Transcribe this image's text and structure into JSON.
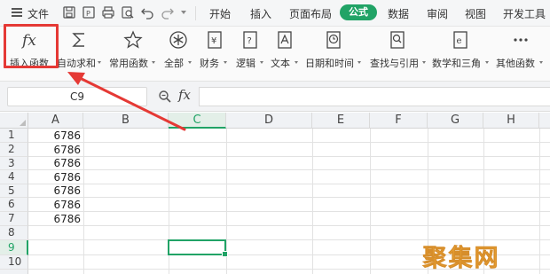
{
  "menubar": {
    "file_label": "文件",
    "tabs": [
      {
        "label": "开始",
        "active": false
      },
      {
        "label": "插入",
        "active": false
      },
      {
        "label": "页面布局",
        "active": false
      },
      {
        "label": "公式",
        "active": true
      },
      {
        "label": "数据",
        "active": false
      },
      {
        "label": "审阅",
        "active": false
      },
      {
        "label": "视图",
        "active": false
      },
      {
        "label": "开发工具",
        "active": false
      }
    ],
    "quick_access_icons": [
      "save-icon",
      "export-icon",
      "print-icon",
      "print-preview-icon",
      "undo-icon",
      "redo-icon"
    ]
  },
  "ribbon": {
    "items": [
      {
        "label": "插入函数",
        "icon": "fx-icon",
        "dropdown": false
      },
      {
        "label": "自动求和",
        "icon": "sigma-icon",
        "dropdown": true
      },
      {
        "label": "常用函数",
        "icon": "star-icon",
        "dropdown": true
      },
      {
        "label": "全部",
        "icon": "asterisk-icon",
        "dropdown": true
      },
      {
        "label": "财务",
        "icon": "yen-book-icon",
        "dropdown": true
      },
      {
        "label": "逻辑",
        "icon": "question-book-icon",
        "dropdown": true
      },
      {
        "label": "文本",
        "icon": "text-a-book-icon",
        "dropdown": true
      },
      {
        "label": "日期和时间",
        "icon": "clock-book-icon",
        "dropdown": true
      },
      {
        "label": "查找与引用",
        "icon": "search-book-icon",
        "dropdown": true
      },
      {
        "label": "数学和三角",
        "icon": "theta-book-icon",
        "dropdown": true
      },
      {
        "label": "其他函数",
        "icon": "more-dots-icon",
        "dropdown": true
      }
    ]
  },
  "formula_bar": {
    "name_box": "C9",
    "fx_label": "fx",
    "formula": ""
  },
  "sheet": {
    "columns": [
      "A",
      "B",
      "C",
      "D",
      "E",
      "F",
      "G",
      "H"
    ],
    "selected_column": "C",
    "rows": [
      "1",
      "2",
      "3",
      "4",
      "5",
      "6",
      "7",
      "8",
      "9",
      "10"
    ],
    "selected_row": "9",
    "column_a_values": [
      "6786",
      "6786",
      "6786",
      "6786",
      "6786",
      "6786",
      "6786"
    ]
  },
  "watermark": {
    "text": "聚集网"
  },
  "colors": {
    "accent_green": "#21a366",
    "annotation_red": "#e53935",
    "watermark_orange": "#f5a623"
  }
}
